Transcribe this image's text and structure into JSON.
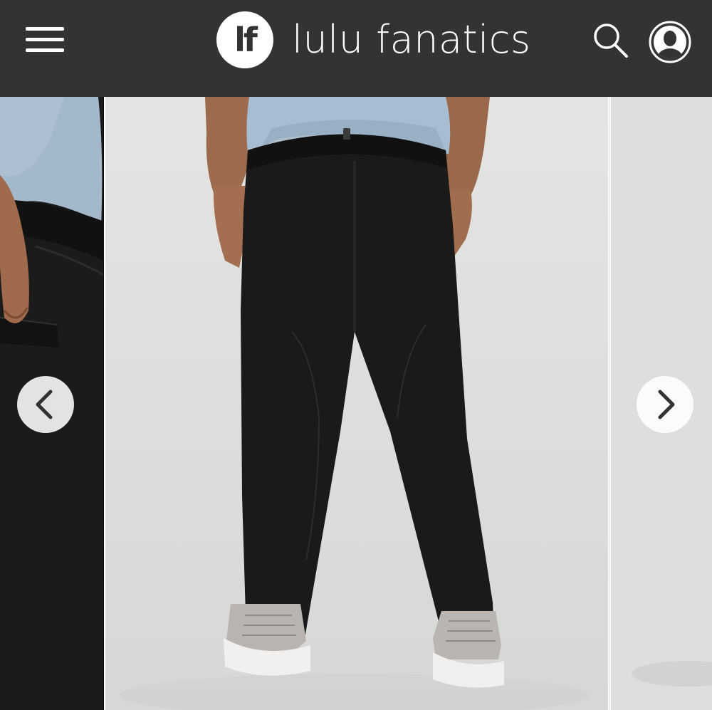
{
  "header": {
    "logo_text": "lf",
    "brand_name": "lulu fanatics",
    "menu_icon": "hamburger-menu-icon",
    "search_icon": "search-icon",
    "profile_icon": "user-profile-icon",
    "background_color": "#333333"
  },
  "gallery": {
    "prev_icon": "chevron-left-icon",
    "next_icon": "chevron-right-icon",
    "images": [
      {
        "role": "previous",
        "subject": "close-up of black pants back pocket with blue tee"
      },
      {
        "role": "current",
        "subject": "model wearing black slim pants, light blue tee and grey sneakers"
      },
      {
        "role": "next",
        "subject": "partially visible next product photo"
      }
    ]
  }
}
